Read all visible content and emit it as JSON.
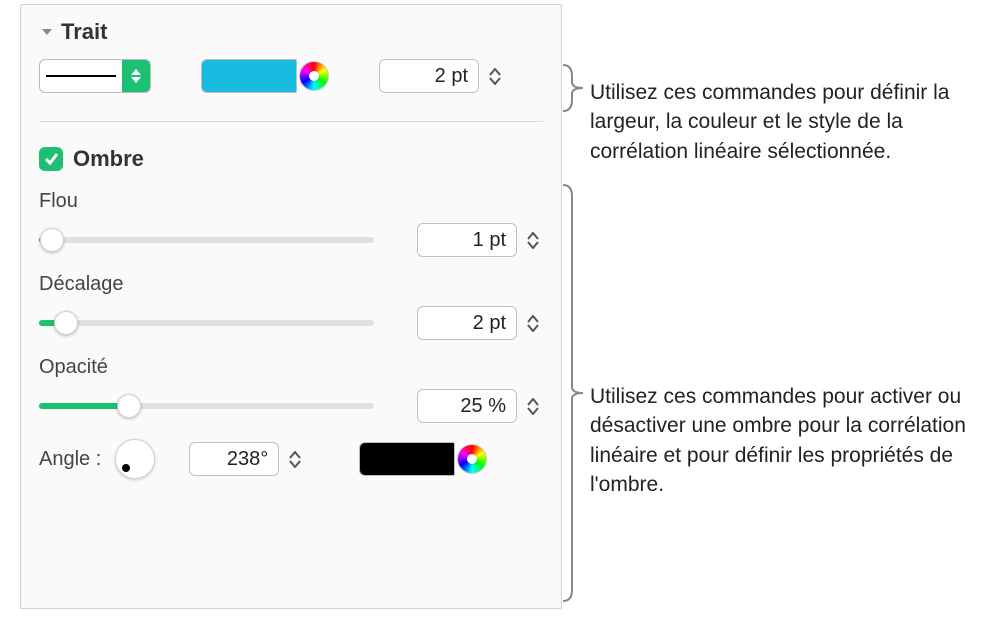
{
  "trait": {
    "title": "Trait",
    "width_value": "2 pt",
    "color": "#18bce0"
  },
  "shadow": {
    "title": "Ombre",
    "checked": true,
    "blur": {
      "label": "Flou",
      "value": "1 pt",
      "slider_percent": 2
    },
    "offset": {
      "label": "Décalage",
      "value": "2 pt",
      "slider_percent": 6
    },
    "opacity": {
      "label": "Opacité",
      "value": "25 %",
      "slider_percent": 25
    },
    "angle": {
      "label": "Angle :",
      "value": "238°"
    },
    "color": "#000000"
  },
  "callouts": {
    "c1": "Utilisez ces commandes pour définir la largeur, la couleur et le style de la corrélation linéaire sélectionnée.",
    "c2": "Utilisez ces commandes pour activer ou désactiver une ombre pour la corrélation linéaire et pour définir les propriétés de l'ombre."
  }
}
